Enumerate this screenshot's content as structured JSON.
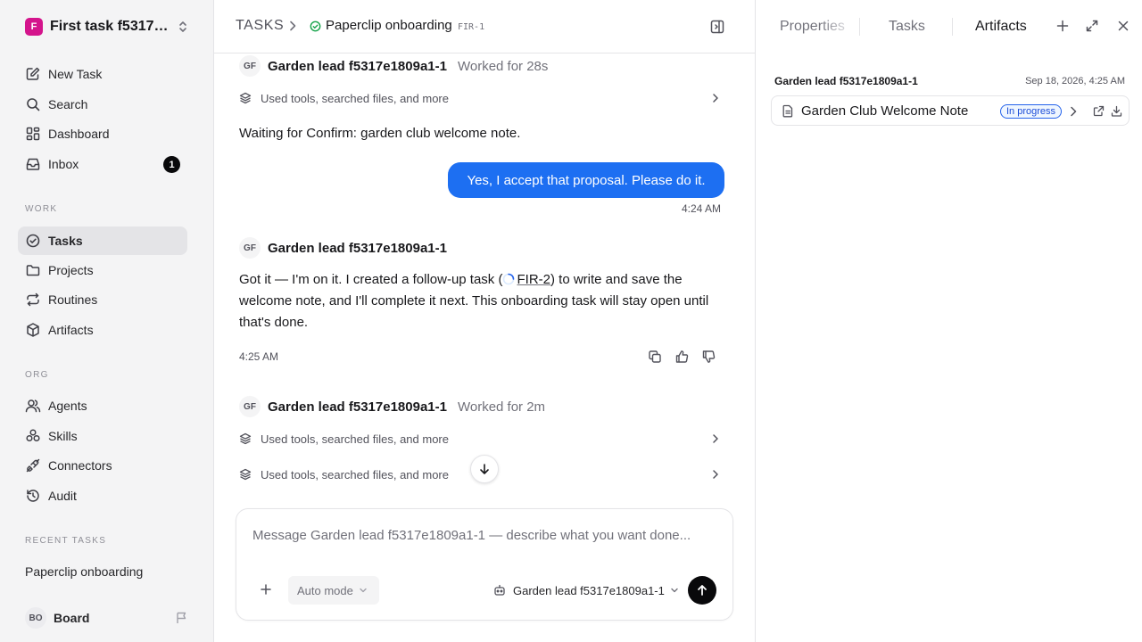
{
  "workspace": {
    "initial": "F",
    "name": "First task f5317e1809a1-1",
    "brand_color": "#d4148c"
  },
  "nav": {
    "new_task": "New Task",
    "search": "Search",
    "dashboard": "Dashboard",
    "inbox": "Inbox",
    "inbox_badge": "1"
  },
  "sections": {
    "work": "WORK",
    "org": "ORG",
    "recent": "RECENT TASKS"
  },
  "work_items": {
    "tasks": "Tasks",
    "projects": "Projects",
    "routines": "Routines",
    "artifacts": "Artifacts"
  },
  "org_items": {
    "agents": "Agents",
    "skills": "Skills",
    "connectors": "Connectors",
    "audit": "Audit"
  },
  "recent": {
    "item1": "Paperclip onboarding"
  },
  "user": {
    "initials": "BO",
    "name": "Board"
  },
  "header": {
    "root": "TASKS",
    "title": "Paperclip onboarding",
    "id": "FIR-1"
  },
  "thread": {
    "msg1": {
      "avatar": "GF",
      "author": "Garden lead f5317e1809a1-1",
      "worked": "Worked for 28s",
      "tools": "Used tools, searched files, and more"
    },
    "waiting": "Waiting for Confirm: garden club welcome note.",
    "user_msg": {
      "text": "Yes, I accept that proposal. Please do it.",
      "time": "4:24 AM",
      "color": "#1d6ff2"
    },
    "msg2": {
      "avatar": "GF",
      "author": "Garden lead f5317e1809a1-1",
      "pre": "Got it — I'm on it. I created a follow-up task (",
      "link": "FIR-2",
      "post": ") to write and save the welcome note, and I'll complete it next. This onboarding task will stay open until that's done.",
      "time": "4:25 AM"
    },
    "msg3": {
      "avatar": "GF",
      "author": "Garden lead f5317e1809a1-1",
      "worked": "Worked for 2m",
      "tools1": "Used tools, searched files, and more",
      "tools2": "Used tools, searched files, and more"
    }
  },
  "composer": {
    "placeholder": "Message Garden lead f5317e1809a1-1 — describe what you want done...",
    "mode": "Auto mode",
    "agent": "Garden lead f5317e1809a1-1"
  },
  "panel": {
    "tabs": {
      "properties": "Properties",
      "tasks": "Tasks",
      "artifacts": "Artifacts"
    },
    "artifact": {
      "owner": "Garden lead f5317e1809a1-1",
      "date": "Sep 18, 2026, 4:25 AM",
      "name": "Garden Club Welcome Note",
      "status": "In progress",
      "status_color": "#2563eb"
    }
  }
}
